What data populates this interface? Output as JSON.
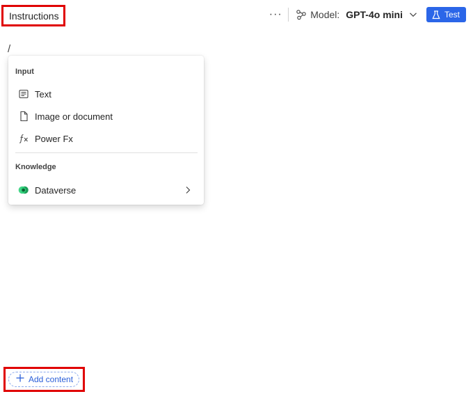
{
  "header": {
    "title": "Instructions",
    "more_label": "···",
    "model_label": "Model:",
    "model_value": "GPT-4o mini",
    "test_label": "Test"
  },
  "editor": {
    "slash": "/"
  },
  "menu": {
    "input_section": "Input",
    "items_input": [
      {
        "label": "Text",
        "icon": "text-icon"
      },
      {
        "label": "Image or document",
        "icon": "document-icon"
      },
      {
        "label": "Power Fx",
        "icon": "fx-icon"
      }
    ],
    "knowledge_section": "Knowledge",
    "items_knowledge": [
      {
        "label": "Dataverse",
        "icon": "dataverse-icon"
      }
    ]
  },
  "footer": {
    "add_content_label": "Add content"
  },
  "colors": {
    "accent": "#2b66e8",
    "highlight_border": "#e00000",
    "link": "#2b5fd9"
  }
}
